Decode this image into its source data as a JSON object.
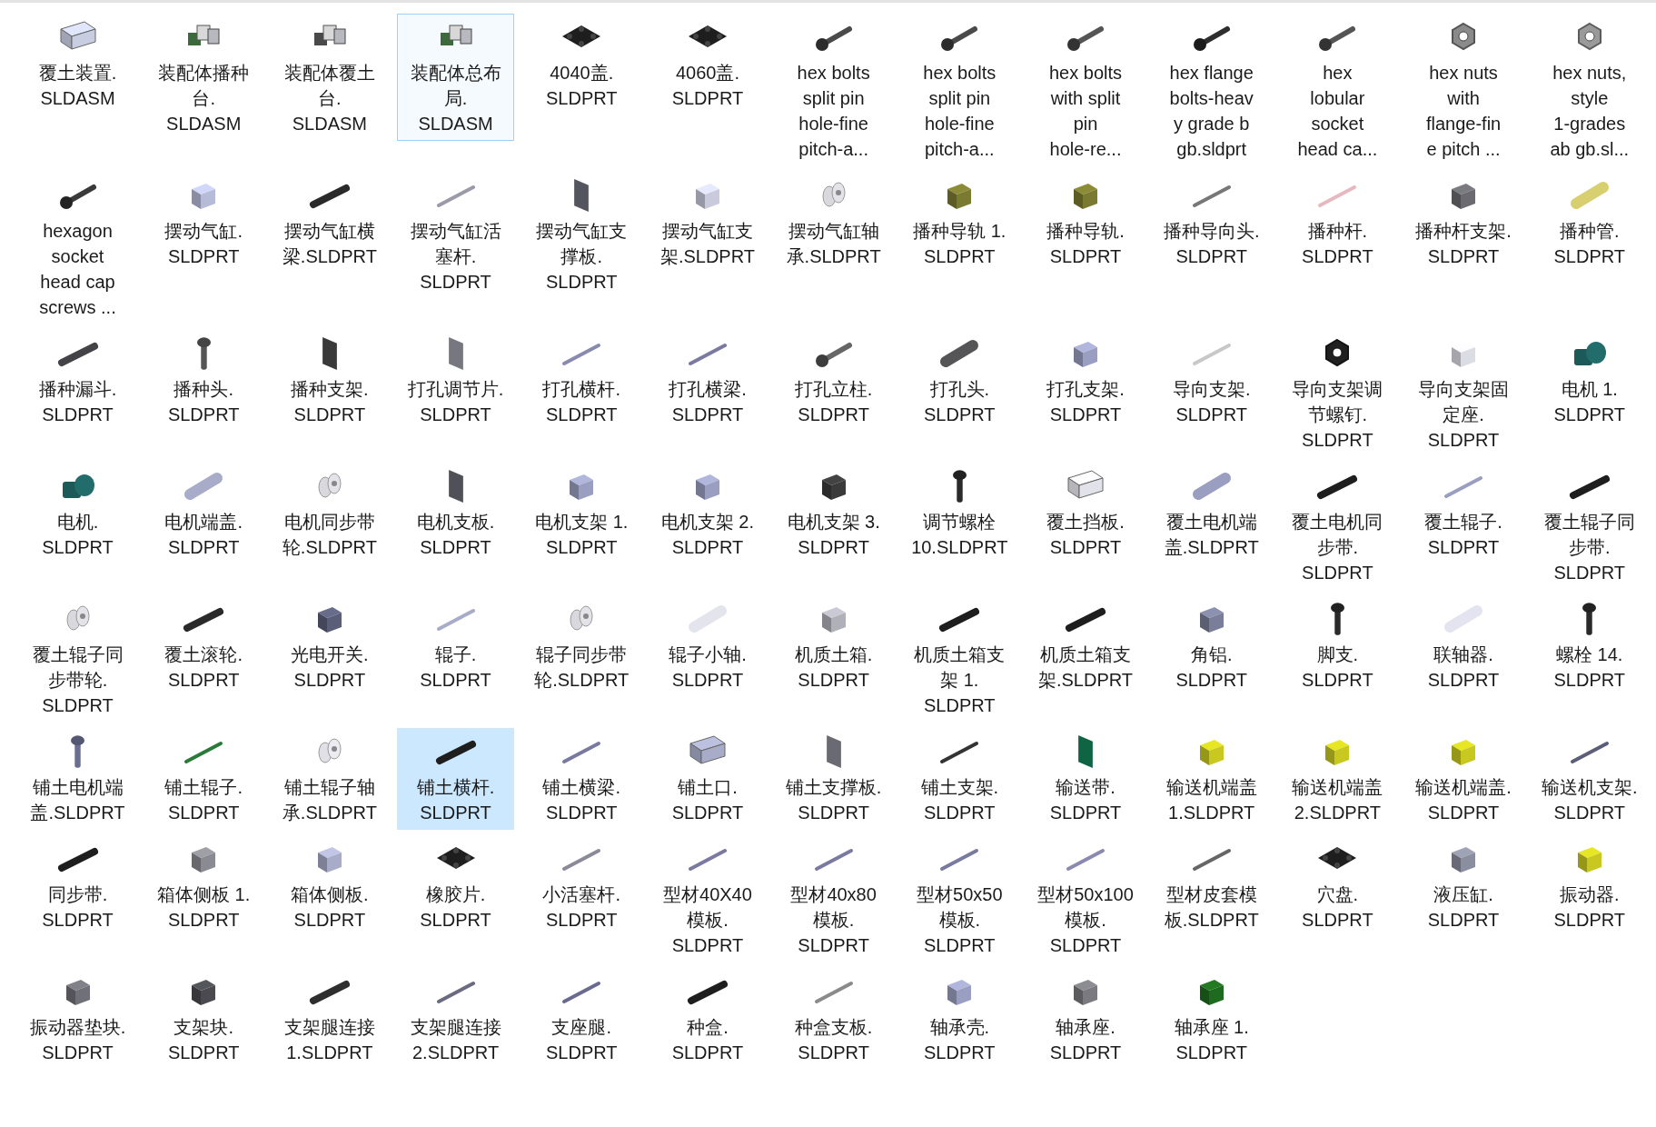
{
  "items": [
    {
      "name": "覆土装置.SLDASM",
      "selected": false,
      "focused": false
    },
    {
      "name": "装配体播种台.SLDASM",
      "selected": false,
      "focused": false
    },
    {
      "name": "装配体覆土台.SLDASM",
      "selected": false,
      "focused": false
    },
    {
      "name": "装配体总布局.SLDASM",
      "selected": false,
      "focused": true
    },
    {
      "name": "4040盖.SLDPRT",
      "selected": false,
      "focused": false
    },
    {
      "name": "4060盖.SLDPRT",
      "selected": false,
      "focused": false
    },
    {
      "name": "hex bolts\nsplit pin\nhole-fine\npitch-a...",
      "selected": false,
      "focused": false
    },
    {
      "name": "hex bolts\nsplit pin\nhole-fine\npitch-a...",
      "selected": false,
      "focused": false
    },
    {
      "name": "hex bolts\nwith split\npin\nhole-re...",
      "selected": false,
      "focused": false
    },
    {
      "name": "hex flange\nbolts-heav\ny grade b\ngb.sldprt",
      "selected": false,
      "focused": false
    },
    {
      "name": "hex\nlobular\nsocket\nhead ca...",
      "selected": false,
      "focused": false
    },
    {
      "name": "hex nuts\nwith\nflange-fin\ne pitch ...",
      "selected": false,
      "focused": false
    },
    {
      "name": "hex nuts,\nstyle\n1-grades\nab gb.sl...",
      "selected": false,
      "focused": false
    },
    {
      "name": "hexagon\nsocket\nhead cap\nscrews ...",
      "selected": false,
      "focused": false
    },
    {
      "name": "摆动气缸.SLDPRT",
      "selected": false,
      "focused": false
    },
    {
      "name": "摆动气缸横梁.SLDPRT",
      "selected": false,
      "focused": false
    },
    {
      "name": "摆动气缸活塞杆.SLDPRT",
      "selected": false,
      "focused": false
    },
    {
      "name": "摆动气缸支撑板.SLDPRT",
      "selected": false,
      "focused": false
    },
    {
      "name": "摆动气缸支架.SLDPRT",
      "selected": false,
      "focused": false
    },
    {
      "name": "摆动气缸轴承.SLDPRT",
      "selected": false,
      "focused": false
    },
    {
      "name": "播种导轨 1.SLDPRT",
      "selected": false,
      "focused": false
    },
    {
      "name": "播种导轨.SLDPRT",
      "selected": false,
      "focused": false
    },
    {
      "name": "播种导向头.SLDPRT",
      "selected": false,
      "focused": false
    },
    {
      "name": "播种杆.SLDPRT",
      "selected": false,
      "focused": false
    },
    {
      "name": "播种杆支架.SLDPRT",
      "selected": false,
      "focused": false
    },
    {
      "name": "播种管.SLDPRT",
      "selected": false,
      "focused": false
    },
    {
      "name": "播种漏斗.SLDPRT",
      "selected": false,
      "focused": false
    },
    {
      "name": "播种头.SLDPRT",
      "selected": false,
      "focused": false
    },
    {
      "name": "播种支架.SLDPRT",
      "selected": false,
      "focused": false
    },
    {
      "name": "打孔调节片.SLDPRT",
      "selected": false,
      "focused": false
    },
    {
      "name": "打孔横杆.SLDPRT",
      "selected": false,
      "focused": false
    },
    {
      "name": "打孔横梁.SLDPRT",
      "selected": false,
      "focused": false
    },
    {
      "name": "打孔立柱.SLDPRT",
      "selected": false,
      "focused": false
    },
    {
      "name": "打孔头.SLDPRT",
      "selected": false,
      "focused": false
    },
    {
      "name": "打孔支架.SLDPRT",
      "selected": false,
      "focused": false
    },
    {
      "name": "导向支架.SLDPRT",
      "selected": false,
      "focused": false
    },
    {
      "name": "导向支架调节螺钉.SLDPRT",
      "selected": false,
      "focused": false
    },
    {
      "name": "导向支架固定座.SLDPRT",
      "selected": false,
      "focused": false
    },
    {
      "name": "电机 1.SLDPRT",
      "selected": false,
      "focused": false
    },
    {
      "name": "电机.SLDPRT",
      "selected": false,
      "focused": false
    },
    {
      "name": "电机端盖.SLDPRT",
      "selected": false,
      "focused": false
    },
    {
      "name": "电机同步带轮.SLDPRT",
      "selected": false,
      "focused": false
    },
    {
      "name": "电机支板.SLDPRT",
      "selected": false,
      "focused": false
    },
    {
      "name": "电机支架 1.SLDPRT",
      "selected": false,
      "focused": false
    },
    {
      "name": "电机支架 2.SLDPRT",
      "selected": false,
      "focused": false
    },
    {
      "name": "电机支架 3.SLDPRT",
      "selected": false,
      "focused": false
    },
    {
      "name": "调节螺栓 10.SLDPRT",
      "selected": false,
      "focused": false
    },
    {
      "name": "覆土挡板.SLDPRT",
      "selected": false,
      "focused": false
    },
    {
      "name": "覆土电机端盖.SLDPRT",
      "selected": false,
      "focused": false
    },
    {
      "name": "覆土电机同步带.SLDPRT",
      "selected": false,
      "focused": false
    },
    {
      "name": "覆土辊子.SLDPRT",
      "selected": false,
      "focused": false
    },
    {
      "name": "覆土辊子同步带.SLDPRT",
      "selected": false,
      "focused": false
    },
    {
      "name": "覆土辊子同步带轮.SLDPRT",
      "selected": false,
      "focused": false
    },
    {
      "name": "覆土滚轮.SLDPRT",
      "selected": false,
      "focused": false
    },
    {
      "name": "光电开关.SLDPRT",
      "selected": false,
      "focused": false
    },
    {
      "name": "辊子.SLDPRT",
      "selected": false,
      "focused": false
    },
    {
      "name": "辊子同步带轮.SLDPRT",
      "selected": false,
      "focused": false
    },
    {
      "name": "辊子小轴.SLDPRT",
      "selected": false,
      "focused": false
    },
    {
      "name": "机质土箱.SLDPRT",
      "selected": false,
      "focused": false
    },
    {
      "name": "机质土箱支架 1.SLDPRT",
      "selected": false,
      "focused": false
    },
    {
      "name": "机质土箱支架.SLDPRT",
      "selected": false,
      "focused": false
    },
    {
      "name": "角铝.SLDPRT",
      "selected": false,
      "focused": false
    },
    {
      "name": "脚支.SLDPRT",
      "selected": false,
      "focused": false
    },
    {
      "name": "联轴器.SLDPRT",
      "selected": false,
      "focused": false
    },
    {
      "name": "螺栓 14.SLDPRT",
      "selected": false,
      "focused": false
    },
    {
      "name": "铺土电机端盖.SLDPRT",
      "selected": false,
      "focused": false
    },
    {
      "name": "铺土辊子.SLDPRT",
      "selected": false,
      "focused": false
    },
    {
      "name": "铺土辊子轴承.SLDPRT",
      "selected": false,
      "focused": false
    },
    {
      "name": "铺土横杆.SLDPRT",
      "selected": true,
      "focused": false
    },
    {
      "name": "铺土横梁.SLDPRT",
      "selected": false,
      "focused": false
    },
    {
      "name": "铺土口.SLDPRT",
      "selected": false,
      "focused": false
    },
    {
      "name": "铺土支撑板.SLDPRT",
      "selected": false,
      "focused": false
    },
    {
      "name": "铺土支架.SLDPRT",
      "selected": false,
      "focused": false
    },
    {
      "name": "输送带.SLDPRT",
      "selected": false,
      "focused": false
    },
    {
      "name": "输送机端盖 1.SLDPRT",
      "selected": false,
      "focused": false
    },
    {
      "name": "输送机端盖 2.SLDPRT",
      "selected": false,
      "focused": false
    },
    {
      "name": "输送机端盖.SLDPRT",
      "selected": false,
      "focused": false
    },
    {
      "name": "输送机支架.SLDPRT",
      "selected": false,
      "focused": false
    },
    {
      "name": "同步带.SLDPRT",
      "selected": false,
      "focused": false
    },
    {
      "name": "箱体侧板 1.SLDPRT",
      "selected": false,
      "focused": false
    },
    {
      "name": "箱体侧板.SLDPRT",
      "selected": false,
      "focused": false
    },
    {
      "name": "橡胶片.SLDPRT",
      "selected": false,
      "focused": false
    },
    {
      "name": "小活塞杆.SLDPRT",
      "selected": false,
      "focused": false
    },
    {
      "name": "型材40X40模板.SLDPRT",
      "selected": false,
      "focused": false
    },
    {
      "name": "型材40x80模板.SLDPRT",
      "selected": false,
      "focused": false
    },
    {
      "name": "型材50x50模板.SLDPRT",
      "selected": false,
      "focused": false
    },
    {
      "name": "型材50x100模板.SLDPRT",
      "selected": false,
      "focused": false
    },
    {
      "name": "型材皮套模板.SLDPRT",
      "selected": false,
      "focused": false
    },
    {
      "name": "穴盘.SLDPRT",
      "selected": false,
      "focused": false
    },
    {
      "name": "液压缸.SLDPRT",
      "selected": false,
      "focused": false
    },
    {
      "name": "振动器.SLDPRT",
      "selected": false,
      "focused": false
    },
    {
      "name": "振动器垫块.SLDPRT",
      "selected": false,
      "focused": false
    },
    {
      "name": "支架块.SLDPRT",
      "selected": false,
      "focused": false
    },
    {
      "name": "支架腿连接 1.SLDPRT",
      "selected": false,
      "focused": false
    },
    {
      "name": "支架腿连接 2.SLDPRT",
      "selected": false,
      "focused": false
    },
    {
      "name": "支座腿.SLDPRT",
      "selected": false,
      "focused": false
    },
    {
      "name": "种盒.SLDPRT",
      "selected": false,
      "focused": false
    },
    {
      "name": "种盒支板.SLDPRT",
      "selected": false,
      "focused": false
    },
    {
      "name": "轴承壳.SLDPRT",
      "selected": false,
      "focused": false
    },
    {
      "name": "轴承座.SLDPRT",
      "selected": false,
      "focused": false
    },
    {
      "name": "轴承座 1.SLDPRT",
      "selected": false,
      "focused": false
    }
  ]
}
